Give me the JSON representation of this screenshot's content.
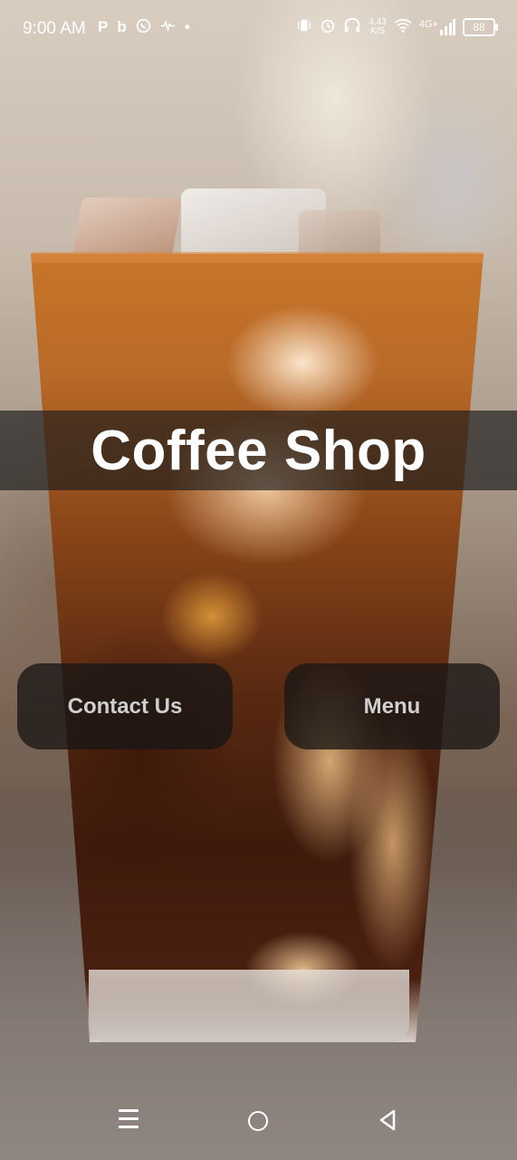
{
  "status_bar": {
    "time": "9:00 AM",
    "left_icons": [
      "p-icon",
      "b-icon",
      "whatsapp-icon",
      "voice-icon",
      "dot-icon"
    ],
    "net_speed_value": "4.43",
    "net_speed_unit": "K/S",
    "network_type": "4G+",
    "battery": "88"
  },
  "hero": {
    "title": "Coffee Shop"
  },
  "buttons": {
    "contact": "Contact Us",
    "menu": "Menu"
  },
  "colors": {
    "title_band": "#1e1e1e",
    "button_bg": "#191614",
    "button_text": "#cfcfcf",
    "title_text": "#ffffff"
  },
  "nav_icons": [
    "recents-icon",
    "home-icon",
    "back-icon"
  ]
}
